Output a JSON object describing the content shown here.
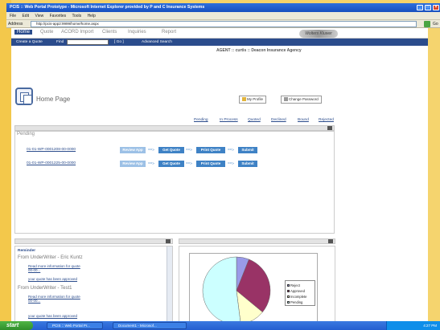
{
  "window": {
    "title": "PCIS :: Web Portal Prototype - Microsoft Internet Explorer provided by P and C Insurance Systems",
    "controls": [
      "minimize",
      "maximize",
      "close"
    ]
  },
  "menu": [
    "File",
    "Edit",
    "View",
    "Favorites",
    "Tools",
    "Help"
  ],
  "address": {
    "label": "Address",
    "url": "http://pcis-app2:9999/home/home.aspx",
    "go_label": "Go"
  },
  "nav": {
    "tabs": [
      "Home",
      "Quote",
      "ACORD Import",
      "Clients",
      "Inquiries",
      "Report"
    ],
    "logo": "Wolters Kluwer"
  },
  "subnav": {
    "create_quote": "Create a Quote",
    "find_label": "Find",
    "find_value": "",
    "go_label": "[ Go ]",
    "advanced": "Advanced Search"
  },
  "agent_line": "AGENT :: curtis  ::  Deacon Insurance Agency",
  "page": {
    "title": "Home Page",
    "my_profile": "My Profile",
    "change_password": "Change Password"
  },
  "status_links": [
    "Pending",
    "In Process",
    "Quoted",
    "Declined",
    "Bound",
    "Rejected"
  ],
  "pending": {
    "title": "Pending",
    "rows": [
      {
        "quote": "01-01-WP-0001208-00-0000"
      },
      {
        "quote": "01-01-WP-0001225-00-0000"
      }
    ],
    "workflow": [
      "Review App",
      "Get Quote",
      "Print Quote",
      "Submit"
    ],
    "arrow": "==>"
  },
  "reminder": {
    "title": "Reminder",
    "groups": [
      {
        "from": "From UnderWriter - Eric Kuntz",
        "links": [
          "Read more information for quote 00-00...",
          "your quote has been approved"
        ]
      },
      {
        "from": "From UnderWriter - Test1",
        "links": [
          "Read more information for quote 00-00...",
          "your quote has been approved"
        ]
      }
    ]
  },
  "chart_data": {
    "type": "pie",
    "legend_position": "right",
    "categories": [
      "Reject",
      "Approved",
      "Incomplete",
      "Pending"
    ],
    "values": [
      6,
      30,
      12,
      52
    ],
    "colors": [
      "#9a9ae8",
      "#993366",
      "#ffffcc",
      "#ccffff"
    ]
  },
  "taskbar": {
    "start": "start",
    "items": [
      "PCIS :: Web Portal Pr...",
      "Document1 - Microsof..."
    ],
    "clock": "4:27 PM"
  }
}
